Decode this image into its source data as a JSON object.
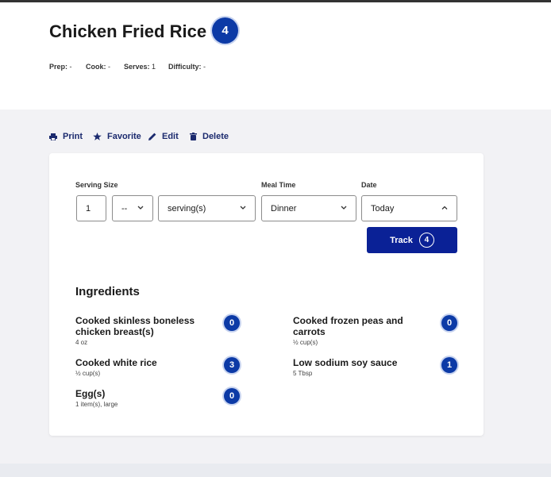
{
  "recipe": {
    "title": "Chicken Fried Rice",
    "points": "4",
    "meta": [
      {
        "label": "Prep:",
        "value": "-"
      },
      {
        "label": "Cook:",
        "value": "-"
      },
      {
        "label": "Serves:",
        "value": "1"
      },
      {
        "label": "Difficulty:",
        "value": "-"
      }
    ]
  },
  "actions": {
    "print": "Print",
    "favorite": "Favorite",
    "edit": "Edit",
    "delete": "Delete"
  },
  "tracker": {
    "serving_size_label": "Serving Size",
    "serving_size_value": "1",
    "fraction_value": "--",
    "unit_value": "serving(s)",
    "meal_time_label": "Meal Time",
    "meal_time_value": "Dinner",
    "date_label": "Date",
    "date_value": "Today",
    "track_label": "Track",
    "track_points": "4"
  },
  "ingredients": {
    "title": "Ingredients",
    "items": [
      {
        "name": "Cooked skinless boneless chicken breast(s)",
        "qty": "4 oz",
        "points": "0"
      },
      {
        "name": "Cooked frozen peas and carrots",
        "qty": "½ cup(s)",
        "points": "0"
      },
      {
        "name": "Cooked white rice",
        "qty": "½ cup(s)",
        "points": "3"
      },
      {
        "name": "Low sodium soy sauce",
        "qty": "5 Tbsp",
        "points": "1"
      },
      {
        "name": "Egg(s)",
        "qty": "1 item(s), large",
        "points": "0"
      }
    ]
  },
  "colors": {
    "accent": "#0c3aa6",
    "button": "#0a2196",
    "link": "#1b2a6e"
  }
}
